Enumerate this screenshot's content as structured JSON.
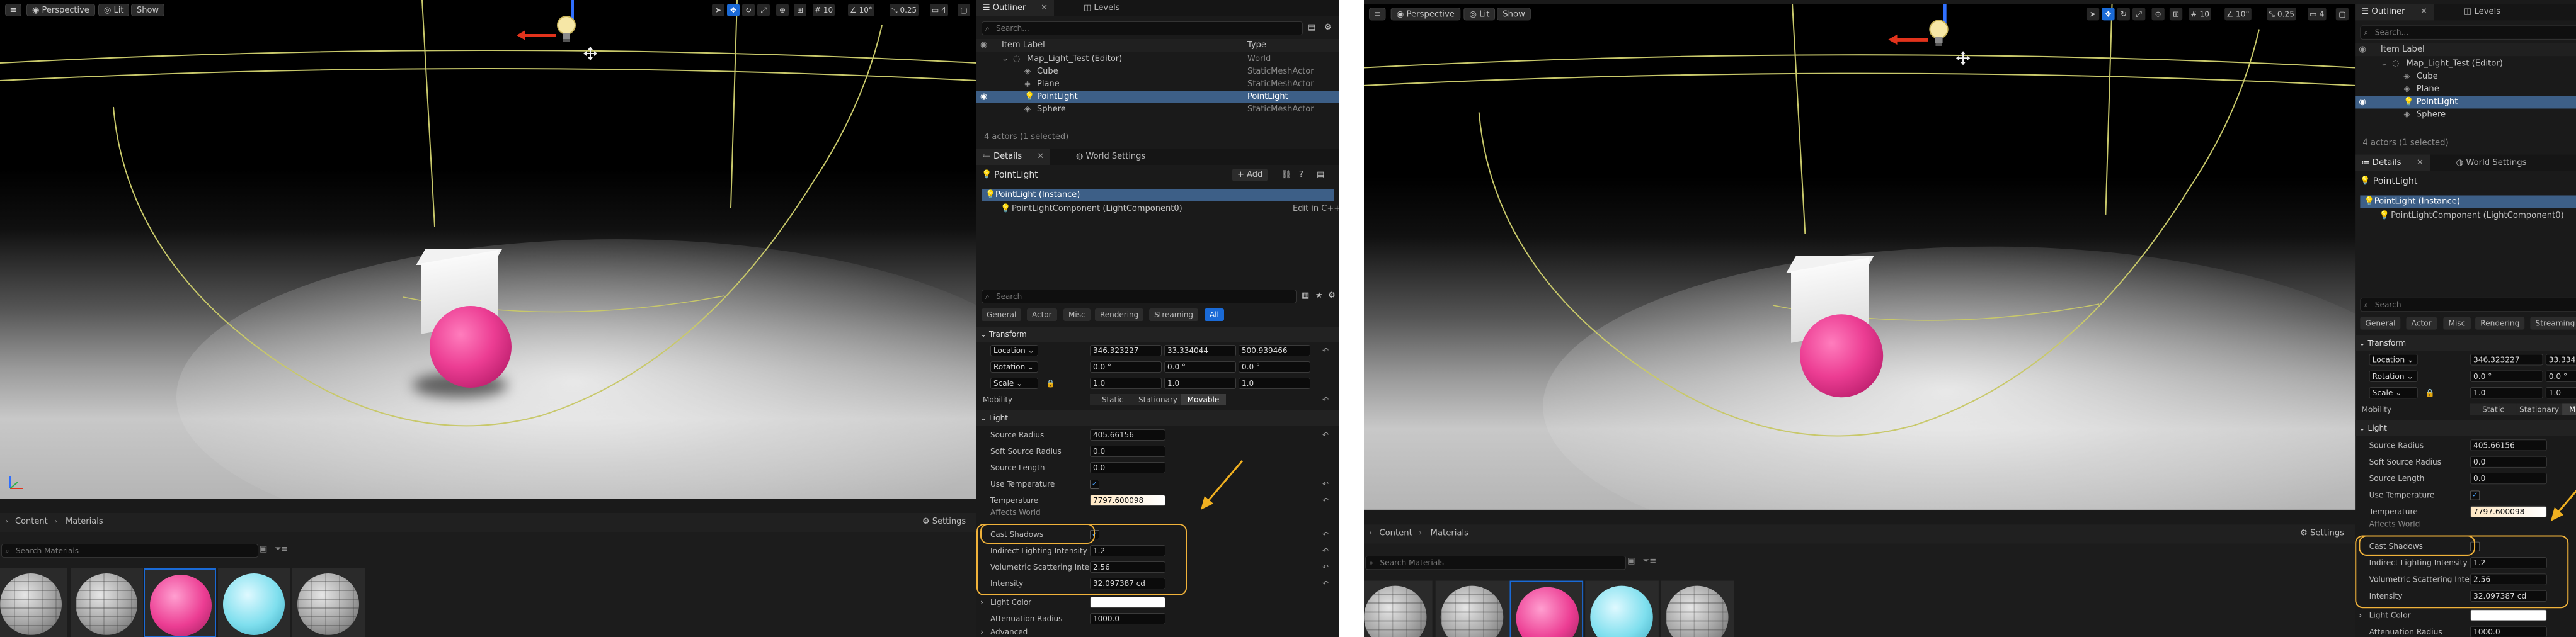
{
  "viewport": {
    "perspective_label": "Perspective",
    "lit_label": "Lit",
    "show_label": "Show",
    "grid_snap_value": "10",
    "rotation_snap_value": "10°",
    "scale_snap_value": "0.25",
    "camera_speed_value": "4"
  },
  "outliner": {
    "tab_label": "Outliner",
    "levels_tab_label": "Levels",
    "search_placeholder": "Search...",
    "col_item_label": "Item Label",
    "col_type": "Type",
    "rows": [
      {
        "label": "Map_Light_Test (Editor)",
        "type": "World"
      },
      {
        "label": "Cube",
        "type": "StaticMeshActor"
      },
      {
        "label": "Plane",
        "type": "StaticMeshActor"
      },
      {
        "label": "PointLight",
        "type": "PointLight"
      },
      {
        "label": "Sphere",
        "type": "StaticMeshActor"
      }
    ],
    "status": "4 actors (1 selected)"
  },
  "details": {
    "tab_label": "Details",
    "world_settings_tab_label": "World Settings",
    "actor_name": "PointLight",
    "add_label": "Add",
    "instance_label": "PointLight (Instance)",
    "component_label": "PointLightComponent (LightComponent0)",
    "edit_in_cpp": "Edit in C++",
    "search_placeholder": "Search",
    "categories": [
      "General",
      "Actor",
      "Misc",
      "Rendering",
      "Streaming",
      "All"
    ],
    "transform_header": "Transform",
    "location_label": "Location",
    "rotation_label": "Rotation",
    "scale_label": "Scale",
    "location": [
      "346.323227",
      "33.334044",
      "500.939466"
    ],
    "rotation": [
      "0.0 °",
      "0.0 °",
      "0.0 °"
    ],
    "scale": [
      "1.0",
      "1.0",
      "1.0"
    ],
    "mobility_label": "Mobility",
    "mobility_options": [
      "Static",
      "Stationary",
      "Movable"
    ],
    "light_header": "Light",
    "props": {
      "source_radius_label": "Source Radius",
      "source_radius": "405.66156",
      "soft_source_radius_label": "Soft Source Radius",
      "soft_source_radius": "0.0",
      "source_length_label": "Source Length",
      "source_length": "0.0",
      "use_temperature_label": "Use Temperature",
      "temperature_label": "Temperature",
      "temperature": "7797.600098",
      "affects_world_label": "Affects World",
      "cast_shadows_label": "Cast Shadows",
      "indirect_label": "Indirect Lighting Intensity",
      "indirect": "1.2",
      "volumetric_label": "Volumetric Scattering Inte...",
      "volumetric": "2.56",
      "intensity_label": "Intensity",
      "intensity": "32.097387 cd",
      "light_color_label": "Light Color",
      "attenuation_label": "Attenuation Radius",
      "attenuation": "1000.0",
      "advanced_label": "Advanced"
    }
  },
  "content_browser": {
    "content_label": "Content",
    "materials_label": "Materials",
    "settings_label": "Settings",
    "search_placeholder": "Search Materials"
  },
  "colors": {
    "accent_blue": "#1a6ad6",
    "selection_row": "#3d5f87",
    "highlight_orange": "#f0b23a",
    "arrow_yellow": "#f0b020"
  }
}
